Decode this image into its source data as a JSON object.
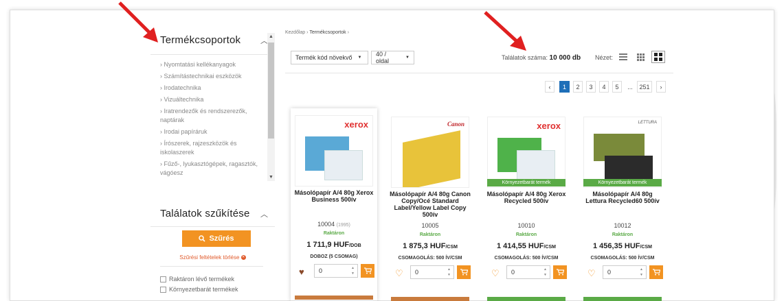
{
  "categories": {
    "title": "Termékcsoportok",
    "items": [
      "› Nyomtatási kellékanyagok",
      "› Számítástechnikai eszközök",
      "› Irodatechnika",
      "› Vizuáltechnika",
      "› Iratrendezők és rendszerezők, naptárak",
      "› Irodai papíráruk",
      "› Írószerek, rajzeszközök és iskolaszerek",
      "› Fűző-, lyukasztógépek, ragasztók, vágóesz"
    ]
  },
  "filter": {
    "title": "Találatok szűkítése",
    "button_label": "Szűrés",
    "clear_label": "Szűrési feltételek törlése",
    "checkboxes": [
      "Raktáron lévő termékek",
      "Környezetbarát termékek"
    ]
  },
  "breadcrumb": {
    "home": "Kezdőlap",
    "sep": "›",
    "current": "Termékcsoportok",
    "sep2": "›"
  },
  "toolbar": {
    "sort_label": "Termék kód növekvő",
    "per_page_label": "40 / oldal",
    "results_prefix": "Találatok száma:",
    "results_count": "10 000 db",
    "view_label": "Nézet:"
  },
  "pagination": [
    "‹",
    "1",
    "2",
    "3",
    "4",
    "5",
    "...",
    "251",
    "›"
  ],
  "products": [
    {
      "brand": "xerox",
      "name": "Másolópapír A/4 80g Xerox Business 500ív",
      "code": "10004",
      "code_note": "(1995)",
      "stock": "Raktáron",
      "price": "1 711,9 HUF",
      "unit": "/DOB",
      "pack": "DOBOZ (5 CSOMAG)",
      "env": "",
      "qty": "0"
    },
    {
      "brand": "Canon",
      "name": "Másolópapír A/4 80g Canon Copy/Océ Standard Label/Yellow Label Copy 500ív",
      "code": "10005",
      "code_note": "",
      "stock": "Raktáron",
      "price": "1 875,3 HUF",
      "unit": "/CSM",
      "pack": "CSOMAGOLÁS: 500 ÍV/CSM",
      "env": "",
      "qty": "0"
    },
    {
      "brand": "xerox",
      "name": "Másolópapír A/4 80g Xerox Recycled 500ív",
      "code": "10010",
      "code_note": "",
      "stock": "Raktáron",
      "price": "1 414,55 HUF",
      "unit": "/CSM",
      "pack": "CSOMAGOLÁS: 500 ÍV/CSM",
      "env": "Környezetbarát termék",
      "qty": "0"
    },
    {
      "brand": "LETTURA",
      "name": "Másolópapír A/4 80g Lettura Recycled60 500ív",
      "code": "10012",
      "code_note": "",
      "stock": "Raktáron",
      "price": "1 456,35 HUF",
      "unit": "/CSM",
      "pack": "CSOMAGOLÁS: 500 ÍV/CSM",
      "env": "Környezetbarát termék",
      "qty": "0"
    }
  ],
  "colors": {
    "accent": "#f29322",
    "pager_active": "#1e6fb8",
    "eco": "#5aaa46",
    "annotation_arrow": "#e02020"
  },
  "icons": [
    "search-icon",
    "cart-icon",
    "heart-icon",
    "list-view-icon",
    "grid-small-icon",
    "grid-large-icon",
    "close-circle-icon"
  ]
}
